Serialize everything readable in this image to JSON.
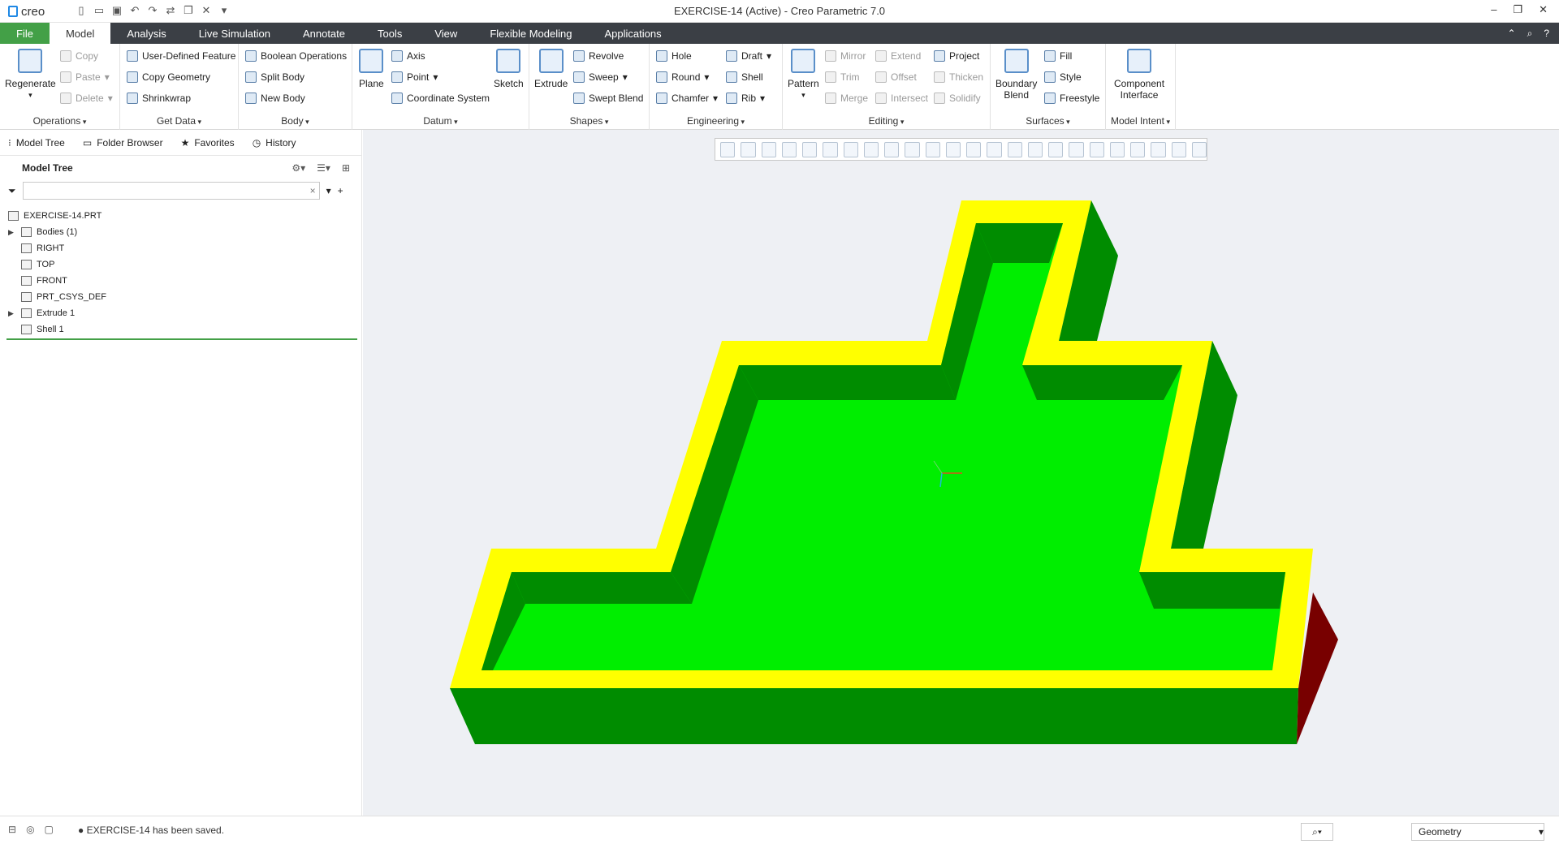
{
  "app": {
    "logo": "creo",
    "title": "EXERCISE-14 (Active) - Creo Parametric 7.0"
  },
  "menu": {
    "items": [
      "File",
      "Model",
      "Analysis",
      "Live Simulation",
      "Annotate",
      "Tools",
      "View",
      "Flexible Modeling",
      "Applications"
    ]
  },
  "ribbon": {
    "operations": {
      "label": "Operations",
      "regenerate": "Regenerate",
      "copy": "Copy",
      "paste": "Paste",
      "delete": "Delete"
    },
    "getdata": {
      "label": "Get Data",
      "udf": "User-Defined Feature",
      "copy_geometry": "Copy Geometry",
      "shrinkwrap": "Shrinkwrap"
    },
    "body": {
      "label": "Body",
      "boolean": "Boolean Operations",
      "split": "Split Body",
      "new": "New Body"
    },
    "datum": {
      "label": "Datum",
      "plane": "Plane",
      "axis": "Axis",
      "point": "Point",
      "csys": "Coordinate System",
      "sketch": "Sketch"
    },
    "shapes": {
      "label": "Shapes",
      "extrude": "Extrude",
      "revolve": "Revolve",
      "sweep": "Sweep",
      "swept_blend": "Swept Blend"
    },
    "engineering": {
      "label": "Engineering",
      "hole": "Hole",
      "round": "Round",
      "chamfer": "Chamfer",
      "draft": "Draft",
      "shell": "Shell",
      "rib": "Rib"
    },
    "editing": {
      "label": "Editing",
      "pattern": "Pattern",
      "mirror": "Mirror",
      "trim": "Trim",
      "merge": "Merge",
      "extend": "Extend",
      "offset": "Offset",
      "intersect": "Intersect",
      "project": "Project",
      "thicken": "Thicken",
      "solidify": "Solidify"
    },
    "surfaces": {
      "label": "Surfaces",
      "boundary_line1": "Boundary",
      "boundary_line2": "Blend",
      "fill": "Fill",
      "style": "Style",
      "freestyle": "Freestyle"
    },
    "modelintent": {
      "label": "Model Intent",
      "ci_line1": "Component",
      "ci_line2": "Interface"
    }
  },
  "navigator": {
    "tabs": [
      "Model Tree",
      "Folder Browser",
      "Favorites",
      "History"
    ],
    "header": "Model Tree"
  },
  "tree": [
    "EXERCISE-14.PRT",
    "Bodies (1)",
    "RIGHT",
    "TOP",
    "FRONT",
    "PRT_CSYS_DEF",
    "Extrude 1",
    "Shell 1"
  ],
  "status": {
    "message": "EXERCISE-14 has been saved.",
    "filter": "Geometry"
  },
  "colors": {
    "top_face": "#ffff00",
    "inner_floor": "#00ee00",
    "walls": "#008c00",
    "dark_side": "#780000",
    "menubar": "#3b3f45",
    "file_tab": "#43a047"
  }
}
